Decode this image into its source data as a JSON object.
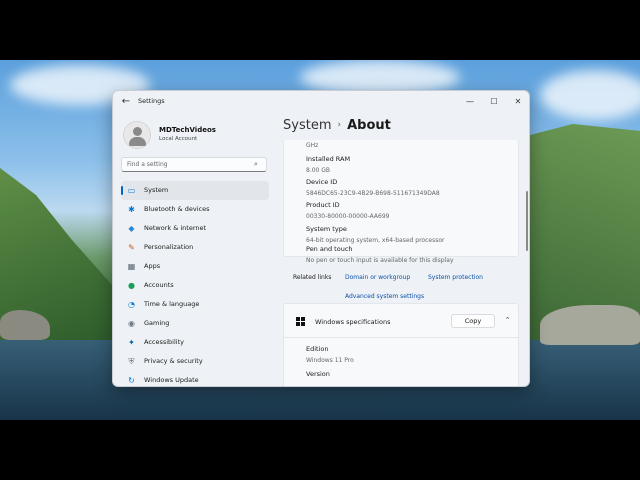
{
  "window": {
    "title": "Settings",
    "back_icon": "←",
    "minimize_icon": "—",
    "maximize_icon": "☐",
    "close_icon": "✕"
  },
  "user": {
    "name": "MDTechVideos",
    "account_type": "Local Account"
  },
  "search": {
    "placeholder": "Find a setting",
    "icon": "⌕"
  },
  "sidebar": {
    "items": [
      {
        "label": "System",
        "icon": "▭",
        "color": "#0078d4",
        "active": true
      },
      {
        "label": "Bluetooth & devices",
        "icon": "✱",
        "color": "#0078d4",
        "active": false
      },
      {
        "label": "Network & internet",
        "icon": "◆",
        "color": "#2b88d8",
        "active": false
      },
      {
        "label": "Personalization",
        "icon": "✎",
        "color": "#c55a1a",
        "active": false
      },
      {
        "label": "Apps",
        "icon": "▦",
        "color": "#5a6472",
        "active": false
      },
      {
        "label": "Accounts",
        "icon": "●",
        "color": "#1aa05a",
        "active": false
      },
      {
        "label": "Time & language",
        "icon": "◔",
        "color": "#0078d4",
        "active": false
      },
      {
        "label": "Gaming",
        "icon": "◉",
        "color": "#6d7683",
        "active": false
      },
      {
        "label": "Accessibility",
        "icon": "✦",
        "color": "#0063b1",
        "active": false
      },
      {
        "label": "Privacy & security",
        "icon": "⛨",
        "color": "#6d7683",
        "active": false
      },
      {
        "label": "Windows Update",
        "icon": "↻",
        "color": "#0078d4",
        "active": false
      }
    ]
  },
  "breadcrumb": {
    "parent": "System",
    "separator": "›",
    "current": "About"
  },
  "device_specs": {
    "freq_tail": "GHz",
    "installed_ram": {
      "label": "Installed RAM",
      "value": "8.00 GB"
    },
    "device_id": {
      "label": "Device ID",
      "value": "5846DC65-23C9-4B29-B698-511671349DA8"
    },
    "product_id": {
      "label": "Product ID",
      "value": "00330-80000-00000-AA699"
    },
    "system_type": {
      "label": "System type",
      "value": "64-bit operating system, x64-based processor"
    },
    "pen_touch": {
      "label": "Pen and touch",
      "value": "No pen or touch input is available for this display"
    }
  },
  "related_links": {
    "label": "Related links",
    "domain": "Domain or workgroup",
    "protection": "System protection",
    "advanced": "Advanced system settings"
  },
  "windows_specs": {
    "title": "Windows specifications",
    "copy_label": "Copy",
    "chevron_icon": "⌃",
    "edition_label": "Edition",
    "edition_value": "Windows 11 Pro",
    "version_label": "Version"
  }
}
